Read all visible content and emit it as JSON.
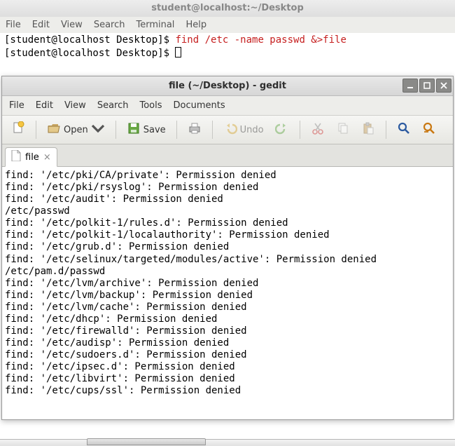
{
  "terminal": {
    "title": "student@localhost:~/Desktop",
    "menu": {
      "file": "File",
      "edit": "Edit",
      "view": "View",
      "search": "Search",
      "terminal": "Terminal",
      "help": "Help"
    },
    "prompt1_a": "[student@localhost Desktop]$ ",
    "prompt1_cmd": "find /etc -name passwd &>file",
    "prompt2_a": "[student@localhost Desktop]$ "
  },
  "gedit": {
    "title": "file (~/Desktop) - gedit",
    "menu": {
      "file": "File",
      "edit": "Edit",
      "view": "View",
      "search": "Search",
      "tools": "Tools",
      "documents": "Documents"
    },
    "toolbar": {
      "open": "Open",
      "save": "Save",
      "undo": "Undo"
    },
    "tab": {
      "name": "file"
    },
    "content": "find: '/etc/pki/CA/private': Permission denied\nfind: '/etc/pki/rsyslog': Permission denied\nfind: '/etc/audit': Permission denied\n/etc/passwd\nfind: '/etc/polkit-1/rules.d': Permission denied\nfind: '/etc/polkit-1/localauthority': Permission denied\nfind: '/etc/grub.d': Permission denied\nfind: '/etc/selinux/targeted/modules/active': Permission denied\n/etc/pam.d/passwd\nfind: '/etc/lvm/archive': Permission denied\nfind: '/etc/lvm/backup': Permission denied\nfind: '/etc/lvm/cache': Permission denied\nfind: '/etc/dhcp': Permission denied\nfind: '/etc/firewalld': Permission denied\nfind: '/etc/audisp': Permission denied\nfind: '/etc/sudoers.d': Permission denied\nfind: '/etc/ipsec.d': Permission denied\nfind: '/etc/libvirt': Permission denied\nfind: '/etc/cups/ssl': Permission denied"
  }
}
